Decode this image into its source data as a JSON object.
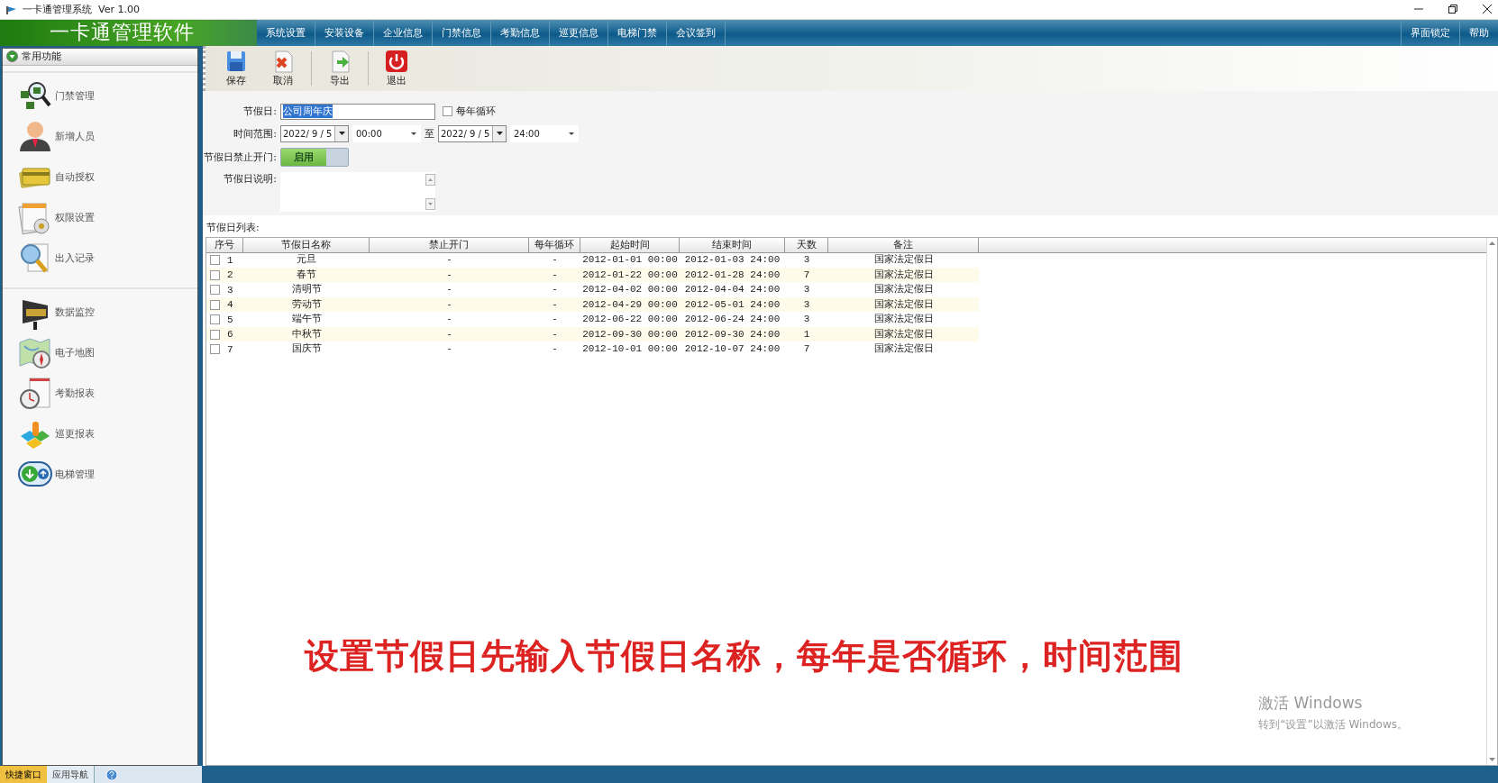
{
  "window": {
    "title": "一卡通管理系统  Ver 1.00"
  },
  "app_title": "一卡通管理软件",
  "menu": [
    "系统设置",
    "安装设备",
    "企业信息",
    "门禁信息",
    "考勤信息",
    "巡更信息",
    "电梯门禁",
    "会议签到"
  ],
  "menu_right": [
    "界面锁定",
    "帮助"
  ],
  "sidebar": {
    "header": "常用功能",
    "groups": [
      [
        "门禁管理",
        "新增人员",
        "自动授权",
        "权限设置",
        "出入记录"
      ],
      [
        "数据监控",
        "电子地图",
        "考勤报表",
        "巡更报表",
        "电梯管理"
      ]
    ]
  },
  "toolbar": [
    {
      "label": "保存",
      "kind": "save"
    },
    {
      "label": "取消",
      "kind": "cancel"
    },
    {
      "label": "导出",
      "kind": "export"
    },
    {
      "label": "退出",
      "kind": "exit"
    }
  ],
  "form": {
    "holiday": {
      "label": "节假日:",
      "value": "公司周年庆",
      "text_selected": true
    },
    "yearly": {
      "label": "每年循环",
      "checked": false
    },
    "range": {
      "label": "时间范围:",
      "start_date": "2022/ 9 / 5",
      "start_time": "00:00",
      "to": "至",
      "end_date": "2022/ 9 / 5",
      "end_time": "24:00"
    },
    "forbid": {
      "label": "节假日禁止开门:",
      "toggle": {
        "label": "启用",
        "on": true
      }
    },
    "description": {
      "label": "节假日说明:"
    }
  },
  "list_label": "节假日列表:",
  "table": {
    "columns": [
      "序号",
      "节假日名称",
      "禁止开门",
      "每年循环",
      "起始时间",
      "结束时间",
      "天数",
      "备注"
    ],
    "rows": [
      {
        "checked": false,
        "cells": [
          "1",
          "元旦",
          "-",
          "-",
          "2012-01-01 00:00",
          "2012-01-03 24:00",
          "3",
          "国家法定假日"
        ]
      },
      {
        "checked": false,
        "cells": [
          "2",
          "春节",
          "-",
          "-",
          "2012-01-22 00:00",
          "2012-01-28 24:00",
          "7",
          "国家法定假日"
        ]
      },
      {
        "checked": false,
        "cells": [
          "3",
          "清明节",
          "-",
          "-",
          "2012-04-02 00:00",
          "2012-04-04 24:00",
          "3",
          "国家法定假日"
        ]
      },
      {
        "checked": false,
        "cells": [
          "4",
          "劳动节",
          "-",
          "-",
          "2012-04-29 00:00",
          "2012-05-01 24:00",
          "3",
          "国家法定假日"
        ]
      },
      {
        "checked": false,
        "cells": [
          "5",
          "端午节",
          "-",
          "-",
          "2012-06-22 00:00",
          "2012-06-24 24:00",
          "3",
          "国家法定假日"
        ]
      },
      {
        "checked": false,
        "cells": [
          "6",
          "中秋节",
          "-",
          "-",
          "2012-09-30 00:00",
          "2012-09-30 24:00",
          "1",
          "国家法定假日"
        ]
      },
      {
        "checked": false,
        "cells": [
          "7",
          "国庆节",
          "-",
          "-",
          "2012-10-01 00:00",
          "2012-10-07 24:00",
          "7",
          "国家法定假日"
        ]
      }
    ]
  },
  "caption": "设置节假日先输入节假日名称，每年是否循环，时间范围",
  "os_notice": {
    "title": "激活 Windows",
    "text": "转到“设置”以激活 Windows。"
  },
  "bottom_tabs": [
    {
      "label": "快捷窗口",
      "selected": true
    },
    {
      "label": "应用导航",
      "selected": false
    }
  ]
}
